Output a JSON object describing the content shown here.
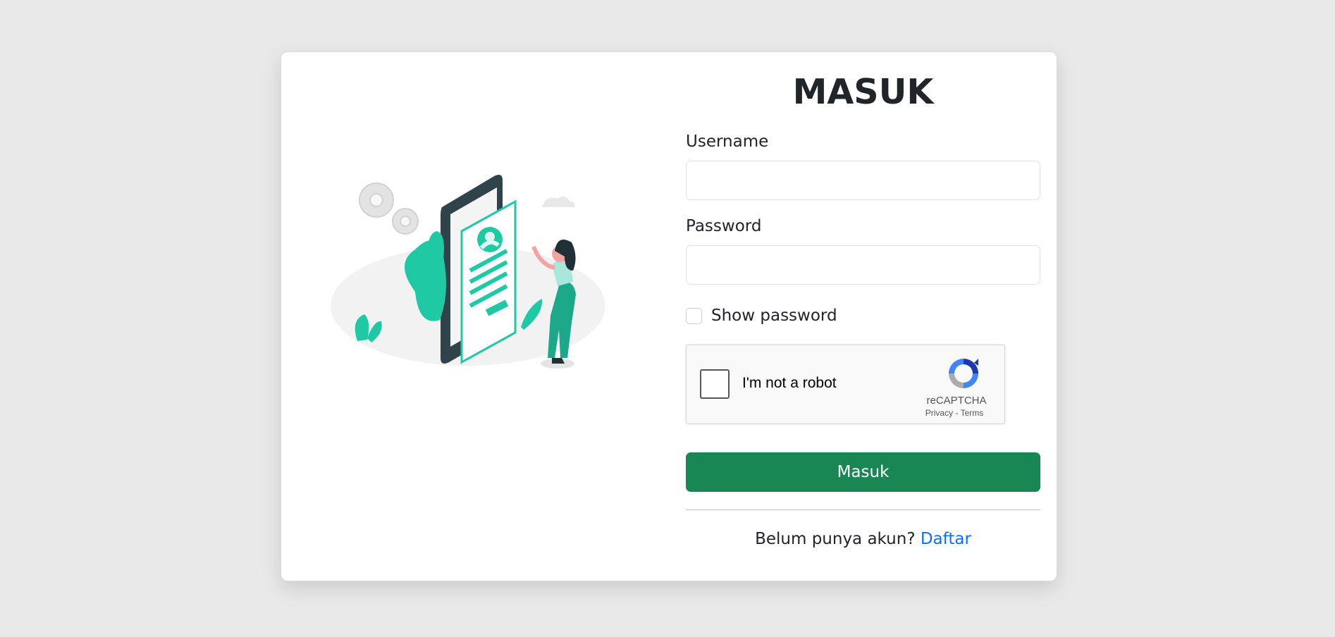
{
  "login": {
    "title": "MASUK",
    "username_label": "Username",
    "username_value": "",
    "password_label": "Password",
    "password_value": "",
    "show_password_label": "Show password",
    "submit_label": "Masuk",
    "register_prompt": "Belum punya akun?",
    "register_link": "Daftar"
  },
  "recaptcha": {
    "label": "I'm not a robot",
    "brand": "reCAPTCHA",
    "privacy": "Privacy",
    "separator": "-",
    "terms": "Terms"
  },
  "colors": {
    "background": "#e9e9e9",
    "primary_button": "#198754",
    "link": "#0d6efd",
    "illustration_accent": "#1ec9a4",
    "phone_dark": "#2f434b"
  },
  "icons": {
    "illustration": "phone-login-illustration",
    "recaptcha_logo": "recaptcha-icon"
  }
}
